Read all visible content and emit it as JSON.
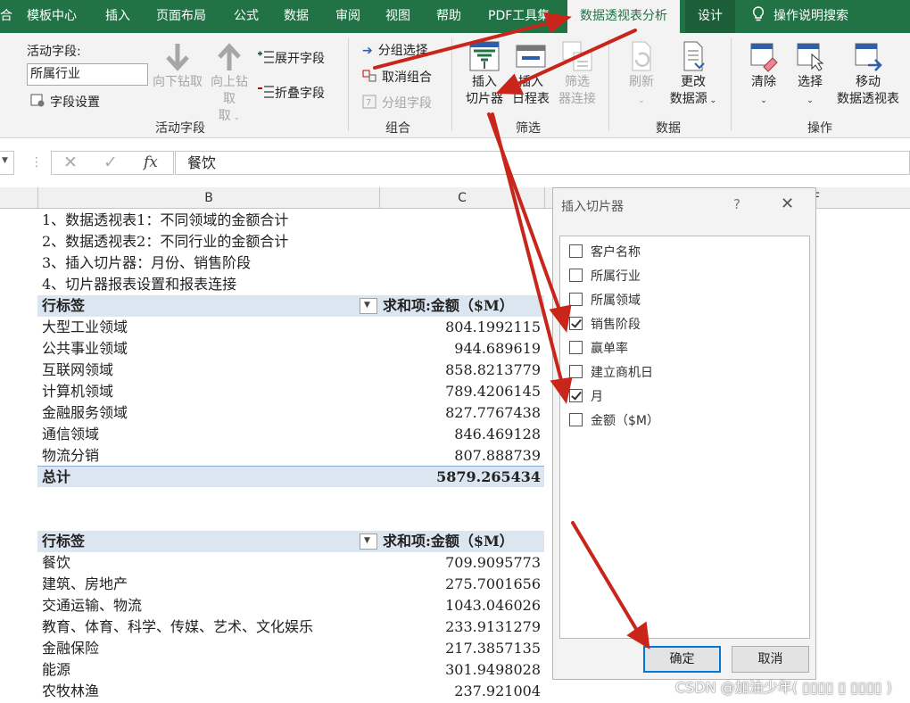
{
  "ribbon_tabs": [
    "合",
    "模板中心",
    "插入",
    "页面布局",
    "公式",
    "数据",
    "审阅",
    "视图",
    "帮助",
    "PDF工具集",
    "数据透视表分析",
    "设计"
  ],
  "tell_me": "操作说明搜索",
  "active_field": {
    "label": "活动字段:",
    "value": "所属行业",
    "settings": "字段设置",
    "drill_down": "向下钻取",
    "drill_up": "向上钻取",
    "drill_up_dropdown": "取",
    "expand": "展开字段",
    "collapse": "折叠字段",
    "group_label": "活动字段"
  },
  "group": {
    "group_selection": "分组选择",
    "ungroup": "取消组合",
    "group_field": "分组字段",
    "group_label": "组合"
  },
  "filter": {
    "slicer_line1": "插入",
    "slicer_line2": "切片器",
    "timeline_line1": "插入",
    "timeline_line2": "日程表",
    "connections_line1": "筛选",
    "connections_line2": "器连接",
    "group_label": "筛选"
  },
  "data_group": {
    "refresh": "刷新",
    "change_line1": "更改",
    "change_line2": "数据源",
    "group_label": "数据"
  },
  "actions": {
    "clear": "清除",
    "select": "选择",
    "move_line1": "移动",
    "move_line2": "数据透视表",
    "group_label": "操作"
  },
  "formula_bar": {
    "value": "餐饮"
  },
  "columns": {
    "b": "B",
    "c": "C",
    "f": "F"
  },
  "notes": [
    "1、数据透视表1：不同领域的金额合计",
    "2、数据透视表2：不同行业的金额合计",
    "3、插入切片器：月份、销售阶段",
    "4、切片器报表设置和报表连接"
  ],
  "pivot1": {
    "row_label": "行标签",
    "value_label": "求和项:金额（$M）",
    "rows": [
      {
        "label": "大型工业领域",
        "value": "804.1992115"
      },
      {
        "label": "公共事业领域",
        "value": "944.689619"
      },
      {
        "label": "互联网领域",
        "value": "858.8213779"
      },
      {
        "label": "计算机领域",
        "value": "789.4206145"
      },
      {
        "label": "金融服务领域",
        "value": "827.7767438"
      },
      {
        "label": "通信领域",
        "value": "846.469128"
      },
      {
        "label": "物流分销",
        "value": "807.888739"
      }
    ],
    "total_label": "总计",
    "total_value": "5879.265434"
  },
  "pivot2": {
    "row_label": "行标签",
    "value_label": "求和项:金额（$M）",
    "rows": [
      {
        "label": "餐饮",
        "value": "709.9095773"
      },
      {
        "label": "建筑、房地产",
        "value": "275.7001656"
      },
      {
        "label": "交通运输、物流",
        "value": "1043.046026"
      },
      {
        "label": "教育、体育、科学、传媒、艺术、文化娱乐",
        "value": "233.9131279"
      },
      {
        "label": "金融保险",
        "value": "217.3857135"
      },
      {
        "label": "能源",
        "value": "301.9498028"
      },
      {
        "label": "农牧林渔",
        "value": "237.921004"
      }
    ]
  },
  "dialog": {
    "title": "插入切片器",
    "help": "?",
    "close": "✕",
    "fields": [
      {
        "label": "客户名称",
        "checked": false
      },
      {
        "label": "所属行业",
        "checked": false
      },
      {
        "label": "所属领域",
        "checked": false
      },
      {
        "label": "销售阶段",
        "checked": true
      },
      {
        "label": "赢单率",
        "checked": false
      },
      {
        "label": "建立商机日",
        "checked": false
      },
      {
        "label": "月",
        "checked": true
      },
      {
        "label": "金额（$M）",
        "checked": false
      }
    ],
    "ok": "确定",
    "cancel": "取消"
  },
  "watermark": "CSDN @加油少年( ▯▯▯▯ ▯ ▯▯▯▯ )",
  "colors": {
    "excel_green": "#217346",
    "pivot_header": "#dce6f1",
    "arrow_red": "#c8261b"
  }
}
